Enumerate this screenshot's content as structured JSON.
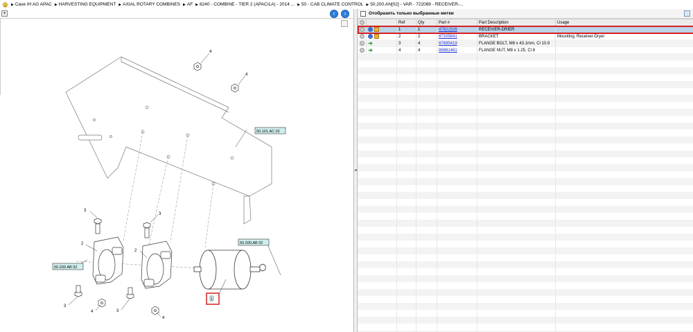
{
  "breadcrumb": [
    "Case IH AG APAC",
    "HARVESTING EQUIPMENT",
    "AXIAL ROTARY COMBINES",
    "AF",
    "8240 - COMBINE - TIER 2 (APAC/LA) - 2014 ...",
    "50 - CAB CLIMATE CONTROL",
    "50.200.AN[02] - VAR - 722089 - RECEIVER-..."
  ],
  "left_toolbar": {
    "expand_label": "+"
  },
  "diagram": {
    "callouts": [
      "4",
      "4",
      "3",
      "3",
      "2",
      "2",
      "3",
      "3",
      "4",
      "4"
    ],
    "ref_boxes": [
      "50.101.AC 02",
      "50.200.AB 02",
      "50.200.AB 02"
    ],
    "highlight_label": "1"
  },
  "filter": {
    "label": "Отобразить только выбранные метки"
  },
  "table": {
    "headers": [
      "",
      "",
      "Ref",
      "Qty",
      "Part #",
      "Part Description",
      "Usage"
    ],
    "rows": [
      {
        "ref": "1",
        "qty": "1",
        "part": "47821526",
        "desc": "RECEIVER-DRIER",
        "usage": "",
        "icons": [
          "gear",
          "box"
        ],
        "selected": true
      },
      {
        "ref": "2",
        "qty": "2",
        "part": "87105841",
        "desc": "BRACKET",
        "usage": "Mounting, Receiver-Dryer",
        "icons": [
          "gear",
          "box"
        ],
        "selected": false
      },
      {
        "ref": "3",
        "qty": "4",
        "part": "87695419",
        "desc": "FLANGE BOLT, M8 x 43.1mm, Cl 10.9",
        "usage": "",
        "icons": [
          "arrow"
        ],
        "selected": false
      },
      {
        "ref": "4",
        "qty": "4",
        "part": "86981461",
        "desc": "FLANGE NUT, M8 x 1.25, Cl 8",
        "usage": "",
        "icons": [
          "arrow"
        ],
        "selected": false
      }
    ]
  },
  "colors": {
    "selected_row": "#bcd3e8",
    "highlight_border": "#d42020",
    "link": "#1a2fd8",
    "nav_button": "#2f7fd8"
  }
}
